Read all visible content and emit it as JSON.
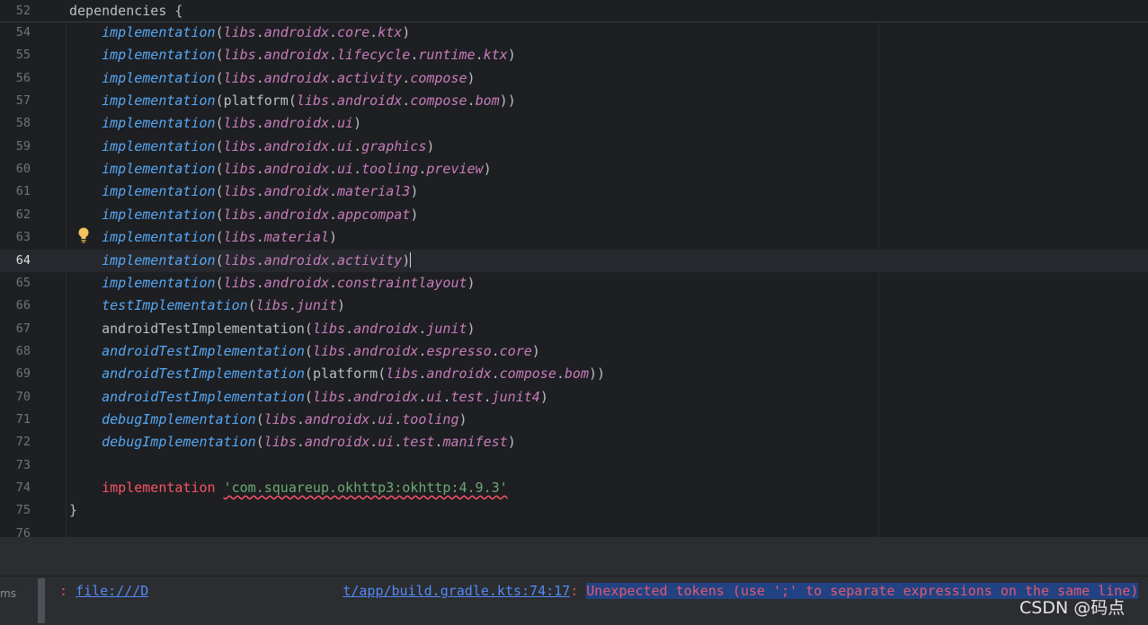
{
  "sticky": {
    "line": "52",
    "text": "dependencies {"
  },
  "lines": [
    {
      "n": "54",
      "kind": "impl",
      "fn": "implementation",
      "arg": "libs.androidx.core.ktx"
    },
    {
      "n": "55",
      "kind": "impl",
      "fn": "implementation",
      "arg": "libs.androidx.lifecycle.runtime.ktx"
    },
    {
      "n": "56",
      "kind": "impl",
      "fn": "implementation",
      "arg": "libs.androidx.activity.compose"
    },
    {
      "n": "57",
      "kind": "impl",
      "fn": "implementation",
      "arg": "libs.androidx.compose.bom"
    },
    {
      "n": "58",
      "kind": "impl",
      "fn": "implementation",
      "arg": "libs.androidx.ui"
    },
    {
      "n": "59",
      "kind": "impl",
      "fn": "implementation",
      "arg": "libs.androidx.ui.graphics"
    },
    {
      "n": "60",
      "kind": "impl",
      "fn": "implementation",
      "arg": "libs.androidx.ui.tooling.preview"
    },
    {
      "n": "61",
      "kind": "impl",
      "fn": "implementation",
      "arg": "libs.androidx.material3"
    },
    {
      "n": "62",
      "kind": "impl",
      "fn": "implementation",
      "arg": "libs.androidx.appcompat"
    },
    {
      "n": "63",
      "kind": "impl",
      "fn": "implementation",
      "arg": "libs.material"
    },
    {
      "n": "64",
      "kind": "impl",
      "fn": "implementation",
      "arg": "libs.androidx.activity"
    },
    {
      "n": "65",
      "kind": "impl",
      "fn": "implementation",
      "arg": "libs.androidx.constraintlayout"
    },
    {
      "n": "66",
      "kind": "impl",
      "fn": "testImplementation",
      "arg": "libs.junit"
    },
    {
      "n": "67",
      "kind": "impl",
      "fn": "androidTestImplementation",
      "arg": "libs.androidx.junit"
    },
    {
      "n": "68",
      "kind": "impl",
      "fn": "androidTestImplementation",
      "arg": "libs.androidx.espresso.core"
    },
    {
      "n": "69",
      "kind": "impl",
      "fn": "androidTestImplementation",
      "arg": "libs.androidx.compose.bom"
    },
    {
      "n": "70",
      "kind": "impl",
      "fn": "androidTestImplementation",
      "arg": "libs.androidx.ui.test.junit4"
    },
    {
      "n": "71",
      "kind": "impl",
      "fn": "debugImplementation",
      "arg": "libs.androidx.ui.tooling"
    },
    {
      "n": "72",
      "kind": "impl",
      "fn": "debugImplementation",
      "arg": "libs.androidx.ui.test.manifest"
    },
    {
      "n": "73",
      "kind": "empty"
    },
    {
      "n": "74",
      "kind": "err",
      "fn": "implementation",
      "arg": "'com.squareup.okhttp3:okhttp:4.9.3'"
    },
    {
      "n": "75",
      "kind": "close",
      "text": "}"
    },
    {
      "n": "76",
      "kind": "empty"
    }
  ],
  "wrapper": "platform",
  "current_line": "64",
  "problems": {
    "side_label": "ms",
    "prefix": ": ",
    "link_start": "file:///D",
    "link_end": "t/app/build.gradle.kts:74:17",
    "sep": ": ",
    "message": "Unexpected tokens (use ';' to separate expressions on the same line)"
  },
  "watermark": "CSDN @码点",
  "colors": {
    "function": "#56a8f5",
    "property": "#c77dbb",
    "error": "#f75464",
    "string": "#6aab73"
  },
  "icons": {
    "intention": "lightbulb-icon"
  }
}
